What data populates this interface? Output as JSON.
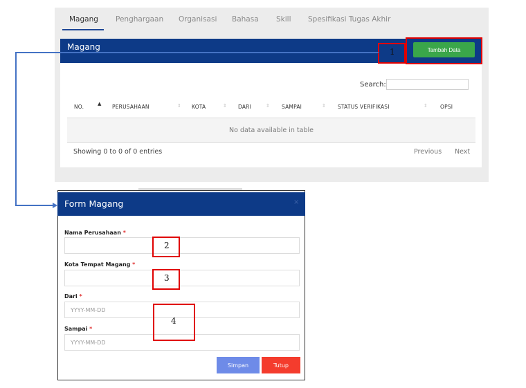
{
  "tabs": [
    "Magang",
    "Penghargaan",
    "Organisasi",
    "Bahasa",
    "Skill",
    "Spesifikasi Tugas Akhir"
  ],
  "card": {
    "title": "Magang",
    "add_button": "Tambah Data"
  },
  "table": {
    "search_label": "Search:",
    "headers": [
      "NO.",
      "PERUSAHAAN",
      "KOTA",
      "DARI",
      "SAMPAI",
      "STATUS VERIFIKASI",
      "OPSI"
    ],
    "empty_text": "No data available in table",
    "info": "Showing 0 to 0 of 0 entries",
    "prev": "Previous",
    "next": "Next"
  },
  "modal": {
    "title": "Form Magang",
    "close_symbol": "×",
    "fields": [
      {
        "label": "Nama Perusahaan",
        "required": "*",
        "placeholder": ""
      },
      {
        "label": "Kota Tempat Magang",
        "required": "*",
        "placeholder": ""
      },
      {
        "label": "Dari",
        "required": "*",
        "placeholder": "YYYY-MM-DD"
      },
      {
        "label": "Sampai",
        "required": "*",
        "placeholder": "YYYY-MM-DD"
      }
    ],
    "save_button": "Simpan",
    "close_button": "Tutup"
  },
  "annotations": [
    "1",
    "2",
    "3",
    "4"
  ],
  "colors": {
    "header_blue": "#0d3a87",
    "add_green": "#3aa64a",
    "annotation_red": "#e00000",
    "connector_blue": "#4472c4",
    "save_blue": "#6e8be8",
    "close_red": "#f43c2d"
  }
}
